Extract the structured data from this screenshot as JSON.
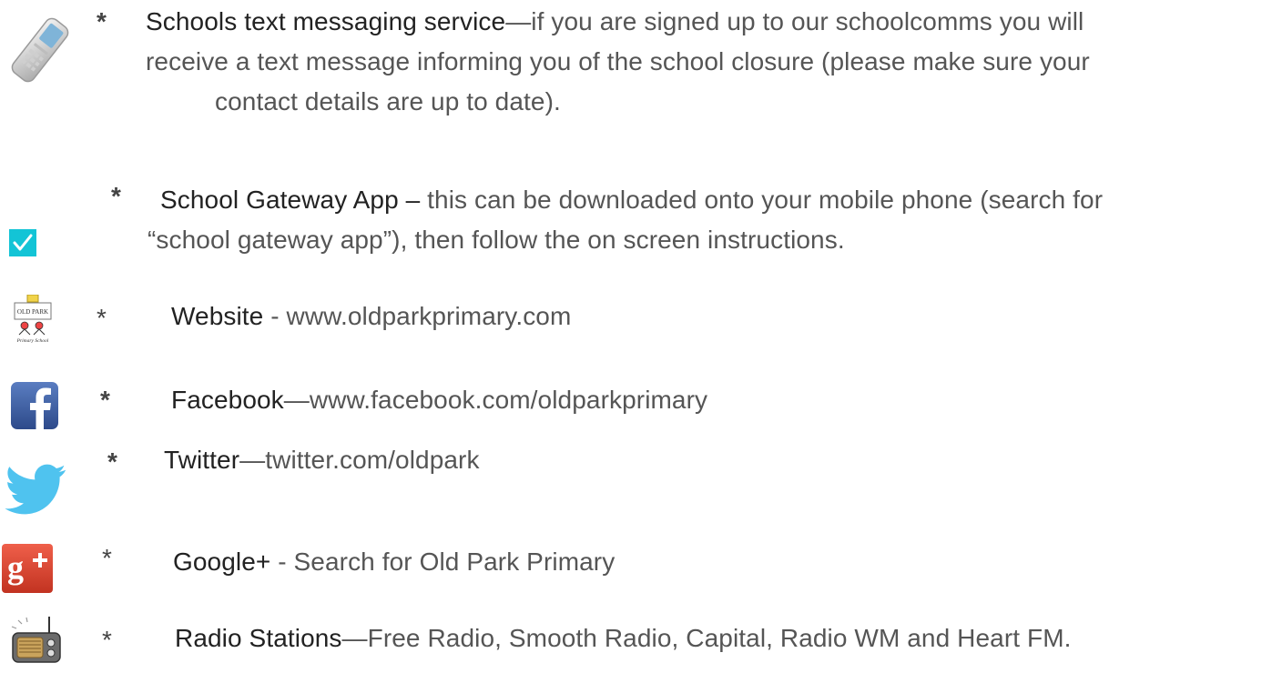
{
  "items": [
    {
      "icon": "mobile-phone-icon",
      "bullet": "*",
      "heading": "Schools text messaging service",
      "lines": [
        "—if you are signed up to our schoolcomms you will",
        "receive a text message informing you of the school closure (please make sure your",
        "contact details are up to date)."
      ]
    },
    {
      "icon": "checkmark-icon",
      "bullet": "*",
      "heading": "School Gateway App –",
      "lines": [
        " this can be downloaded onto your mobile phone (search for",
        "“school gateway app”), then follow the on screen instructions."
      ]
    },
    {
      "icon": "school-logo-icon",
      "logo_text_top": "OLD PARK",
      "logo_text_bottom": "Primary School",
      "bullet": "*",
      "heading": "Website",
      "lines": [
        " - www.oldparkprimary.com"
      ]
    },
    {
      "icon": "facebook-icon",
      "bullet": "*",
      "heading": "Facebook",
      "lines": [
        "—www.facebook.com/oldparkprimary"
      ]
    },
    {
      "icon": "twitter-bird-icon",
      "bullet": "*",
      "heading": "Twitter",
      "lines": [
        "—twitter.com/oldpark"
      ]
    },
    {
      "icon": "google-plus-icon",
      "bullet": "*",
      "heading": "Google+",
      "lines": [
        " - Search for Old Park Primary"
      ]
    },
    {
      "icon": "radio-icon",
      "bullet": "*",
      "heading": "Radio Stations",
      "lines": [
        "—Free Radio, Smooth Radio, Capital, Radio WM and Heart FM."
      ]
    }
  ],
  "colors": {
    "heading": "#222222",
    "body": "#555555",
    "check": "#13c4d6",
    "facebook": "#3b5998",
    "twitter": "#4fc3ef",
    "google": "#dd4b39"
  }
}
